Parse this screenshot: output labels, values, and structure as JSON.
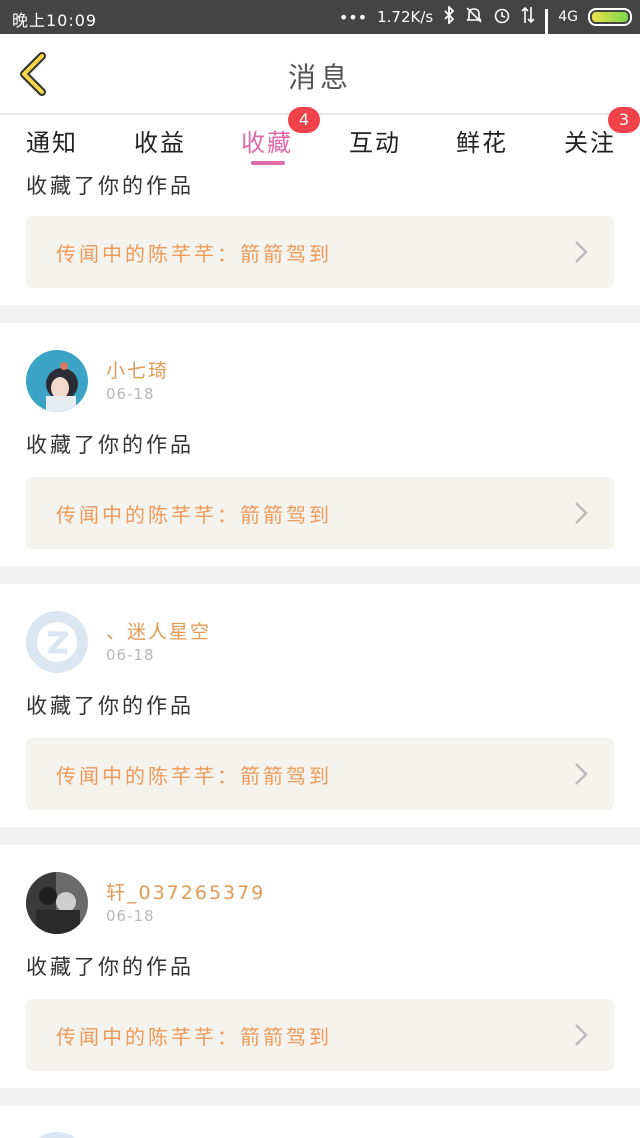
{
  "status_bar": {
    "time": "晚上10:09",
    "network_speed": "1.72K/s",
    "network_type": "4G"
  },
  "header": {
    "title": "消息"
  },
  "tabs": [
    {
      "label": "通知",
      "badge": ""
    },
    {
      "label": "收益",
      "badge": ""
    },
    {
      "label": "收藏",
      "badge": "4",
      "active": true
    },
    {
      "label": "互动",
      "badge": ""
    },
    {
      "label": "鲜花",
      "badge": ""
    },
    {
      "label": "关注",
      "badge": "3"
    }
  ],
  "colors": {
    "accent": "#e26aa5",
    "badge": "#f0424a",
    "username": "#e39a55",
    "work_title": "#ee9a5a"
  },
  "items": [
    {
      "action": "收藏了你的作品",
      "work": "传闻中的陈芊芊：箭箭驾到"
    },
    {
      "username": "小七琦",
      "date": "06-18",
      "action": "收藏了你的作品",
      "work": "传闻中的陈芊芊：箭箭驾到"
    },
    {
      "username": "、迷人星空",
      "date": "06-18",
      "action": "收藏了你的作品",
      "work": "传闻中的陈芊芊：箭箭驾到"
    },
    {
      "username": "轩_037265379",
      "date": "06-18",
      "action": "收藏了你的作品",
      "work": "传闻中的陈芊芊：箭箭驾到"
    }
  ]
}
